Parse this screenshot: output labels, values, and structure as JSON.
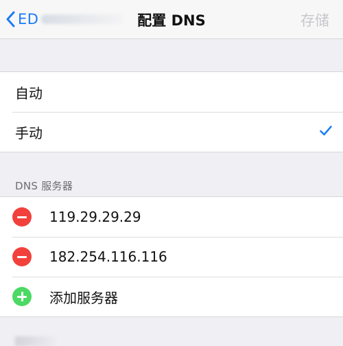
{
  "nav": {
    "back_label": "ED",
    "title": "配置 DNS",
    "save_label": "存储"
  },
  "mode": {
    "options": [
      {
        "label": "自动",
        "selected": false
      },
      {
        "label": "手动",
        "selected": true
      }
    ]
  },
  "dns": {
    "header": "DNS 服务器",
    "servers": [
      "119.29.29.29",
      "182.254.116.116"
    ],
    "add_label": "添加服务器"
  },
  "colors": {
    "accent": "#1a7cf5",
    "delete": "#f2413c",
    "add": "#4cd964",
    "disabled": "#c7c7cc",
    "background": "#efeff4"
  }
}
